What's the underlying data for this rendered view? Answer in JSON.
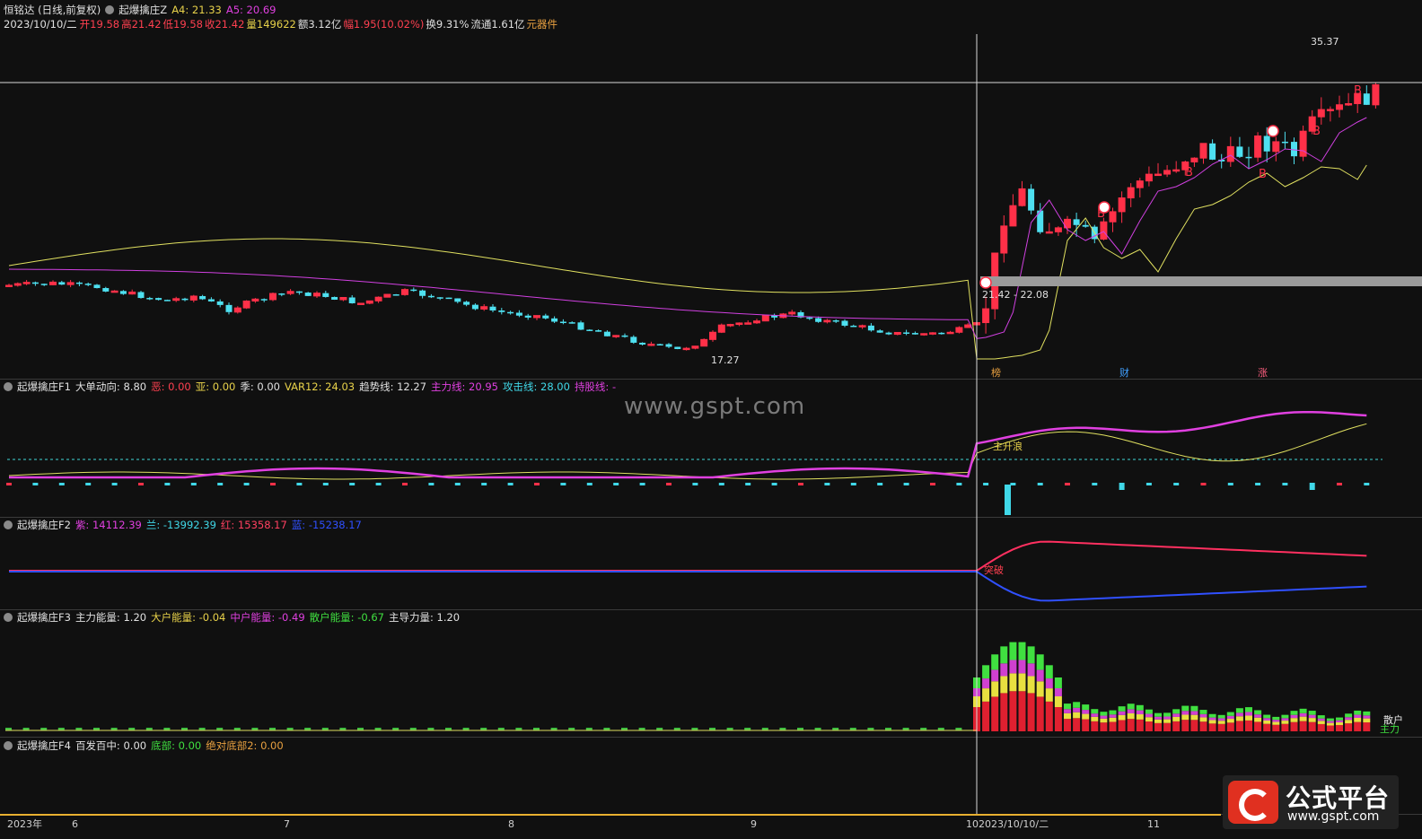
{
  "header": {
    "stock": "恒铭达 (日线,前复权)",
    "indicator_name": "起爆擒庄Z",
    "a4": "A4: 21.33",
    "a5": "A5: 20.69",
    "date": "2023/10/10/二",
    "open": "开19.58",
    "high": "高21.42",
    "low": "低19.58",
    "close": "收21.42",
    "volume": "量149622",
    "amount": "额3.12亿",
    "change": "幅1.95(10.02%)",
    "turnover": "换9.31%",
    "float": "流通1.61亿",
    "sector": "元器件"
  },
  "main_chart": {
    "annotations": {
      "high_label": "35.37",
      "low_label": "17.27",
      "range_label": "21.42 - 22.08",
      "tag1": "榜",
      "tag2": "财",
      "tag3": "涨",
      "buy_mark": "B"
    }
  },
  "panel_f1": {
    "title": "起爆擒庄F1",
    "items": [
      "大单动向: 8.80",
      "恶: 0.00",
      "亚: 0.00",
      "季: 0.00",
      "VAR12: 24.03",
      "趋势线: 12.27",
      "主力线: 20.95",
      "攻击线: 28.00",
      "持股线: -"
    ],
    "signal": "主升浪"
  },
  "panel_f2": {
    "title": "起爆擒庄F2",
    "items": [
      "紫: 14112.39",
      "兰: -13992.39",
      "红: 15358.17",
      "蓝: -15238.17"
    ],
    "signal": "突破"
  },
  "panel_f3": {
    "title": "起爆擒庄F3",
    "items": [
      "主力能量: 1.20",
      "大户能量: -0.04",
      "中户能量: -0.49",
      "散户能量: -0.67",
      "主导力量: 1.20"
    ],
    "right_label1": "散户",
    "right_label2": "主力"
  },
  "panel_f4": {
    "title": "起爆擒庄F4",
    "items": [
      "百发百中: 0.00",
      "底部: 0.00",
      "绝对底部2: 0.00"
    ]
  },
  "time_axis": {
    "labels": [
      "2023年",
      "6",
      "7",
      "8",
      "9",
      "10",
      "2023/10/10/二",
      "11"
    ]
  },
  "watermark": "www.gspt.com",
  "logo": {
    "title": "公式平台",
    "url": "www.gspt.com"
  },
  "chart_data": {
    "type": "candlestick",
    "up_color": "#ff3048",
    "down_color": "#4ee0f0",
    "ma1_color": "#e0e060",
    "ma2_color": "#d040e0",
    "candles": []
  }
}
